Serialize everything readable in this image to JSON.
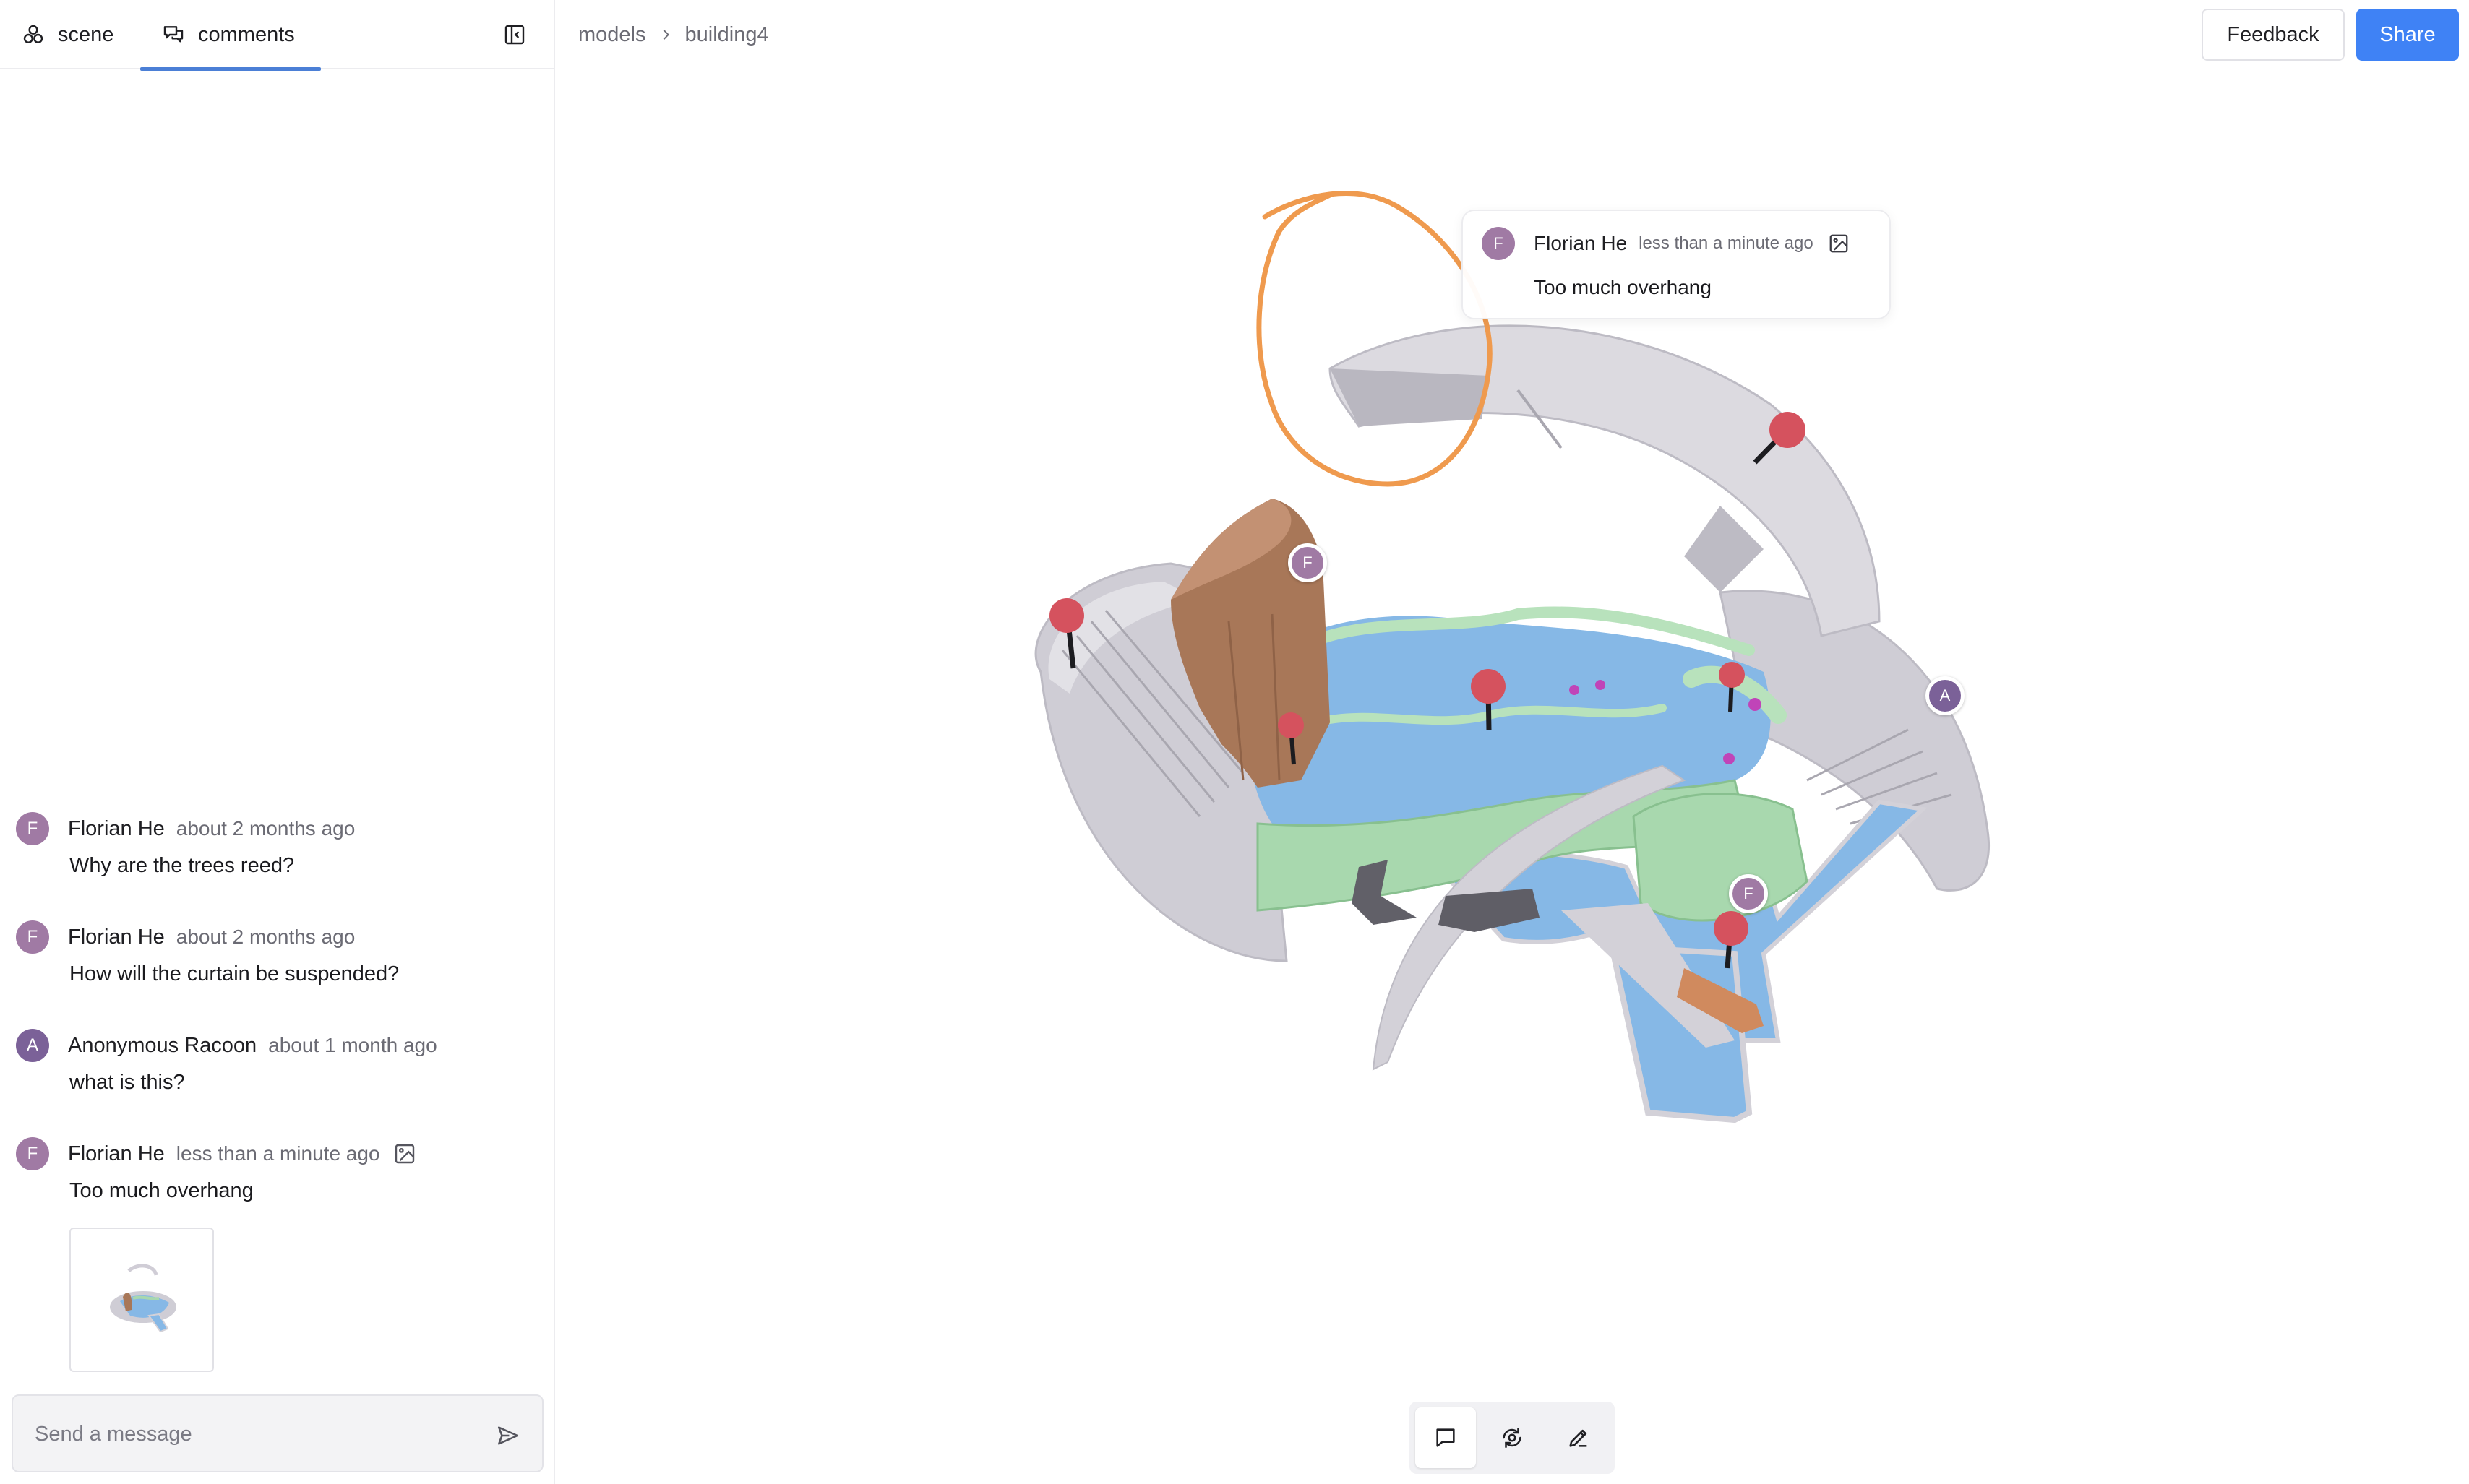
{
  "sidebar": {
    "tabs": [
      {
        "label": "scene",
        "icon": "scene-icon"
      },
      {
        "label": "comments",
        "icon": "comments-icon",
        "active": true
      }
    ],
    "comments": [
      {
        "initial": "F",
        "author": "Florian He",
        "time": "about 2 months ago",
        "text": "Why are the trees reed?",
        "avatar_color": "#a07aa4"
      },
      {
        "initial": "F",
        "author": "Florian He",
        "time": "about 2 months ago",
        "text": "How will the curtain be suspended?",
        "avatar_color": "#a07aa4"
      },
      {
        "initial": "A",
        "author": "Anonymous Racoon",
        "time": "about 1 month ago",
        "text": "what is this?",
        "avatar_color": "#7b6198"
      },
      {
        "initial": "F",
        "author": "Florian He",
        "time": "less than a minute ago",
        "text": "Too much overhang",
        "avatar_color": "#a07aa4",
        "has_image": true
      }
    ],
    "message": {
      "placeholder": "Send a message",
      "value": ""
    }
  },
  "header": {
    "breadcrumb": [
      "models",
      "building4"
    ],
    "feedback_label": "Feedback",
    "share_label": "Share"
  },
  "popup": {
    "initial": "F",
    "author": "Florian He",
    "time": "less than a minute ago",
    "text": "Too much overhang"
  },
  "pins": [
    {
      "initial": "F",
      "color": "#a07aa4"
    },
    {
      "initial": "A",
      "color": "#7b6198"
    },
    {
      "initial": "F",
      "color": "#a07aa4"
    }
  ],
  "toolbar": {
    "tools": [
      "comment-tool",
      "orbit-tool",
      "draw-tool"
    ],
    "active": "comment-tool"
  },
  "colors": {
    "accent": "#3f82f5",
    "tab_underline": "#4b7fd6",
    "annotation_stroke": "#ef9a4e",
    "water": "#86b8e6",
    "greenery": "#a8d8ae",
    "structure": "#d3d1d8"
  }
}
